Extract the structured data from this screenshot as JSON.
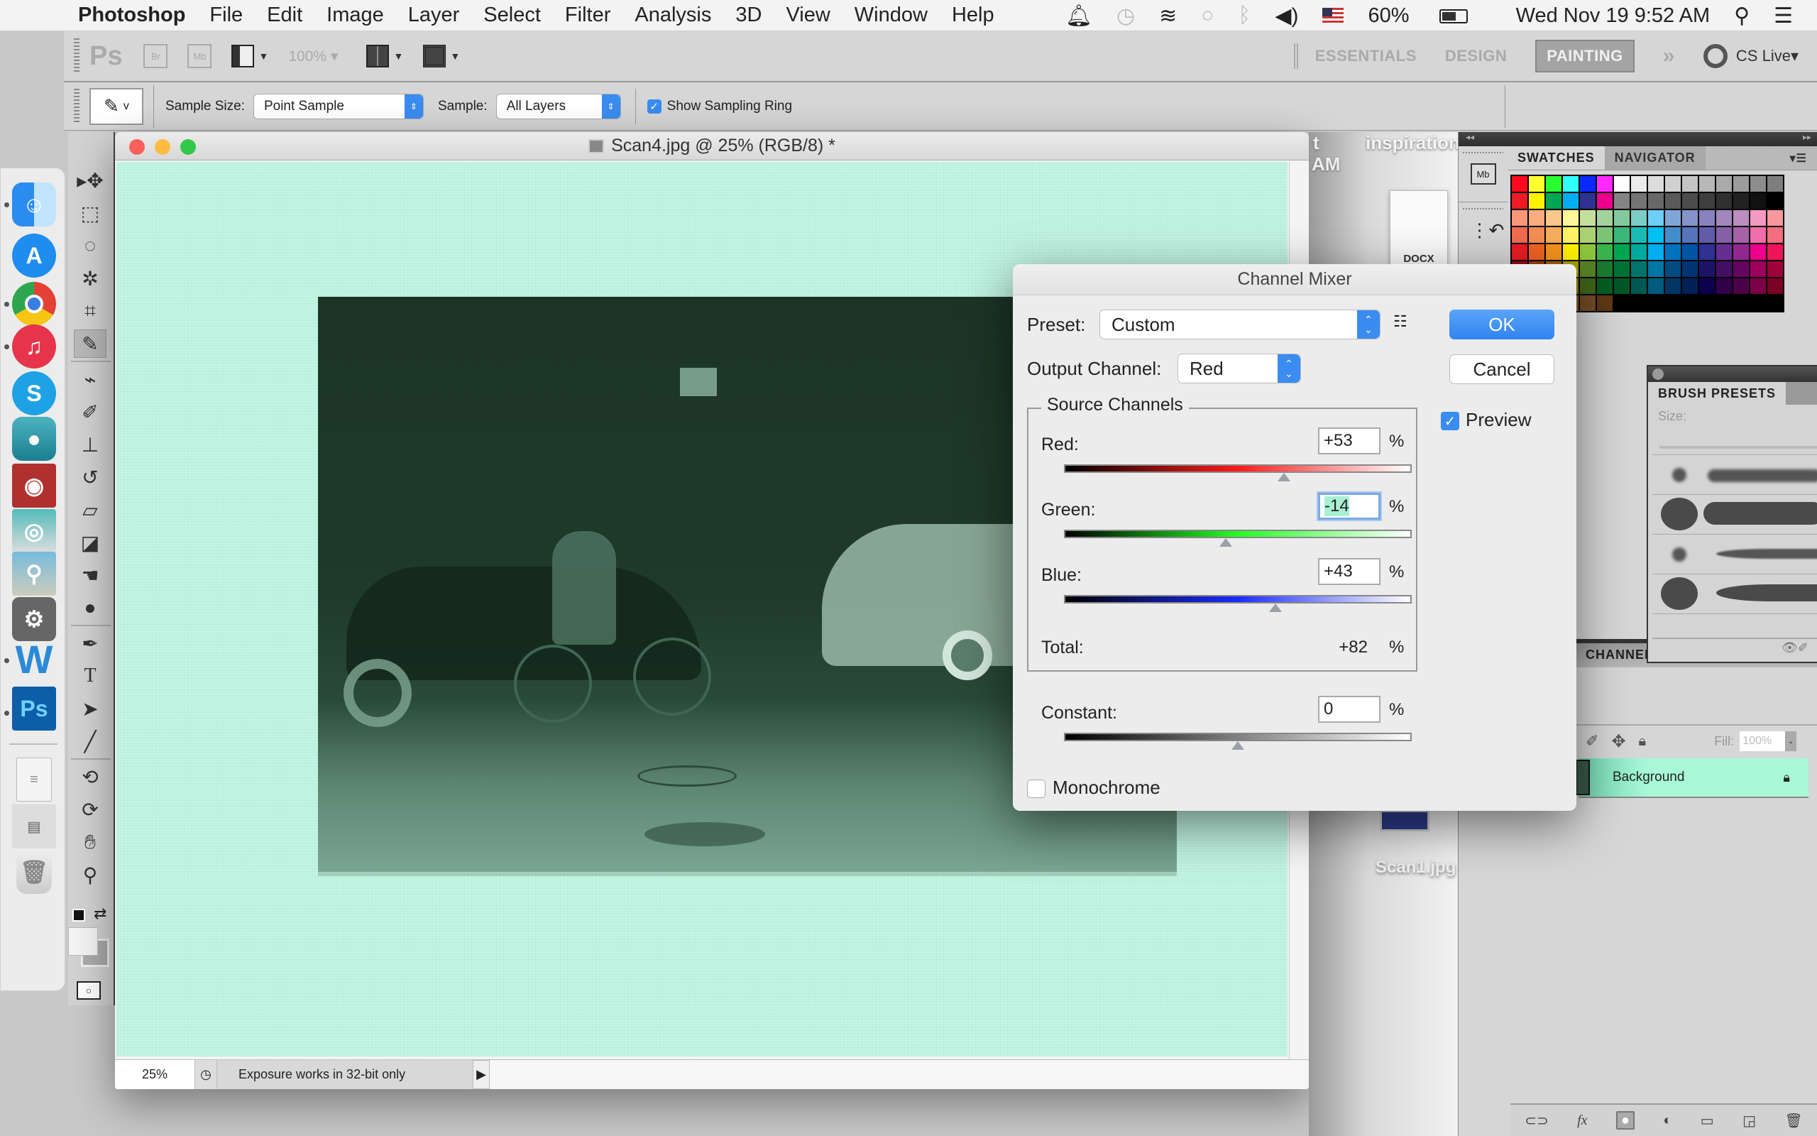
{
  "menubar": {
    "apple": "",
    "app_name": "Photoshop",
    "items": [
      "File",
      "Edit",
      "Image",
      "Layer",
      "Select",
      "Filter",
      "Analysis",
      "3D",
      "View",
      "Window",
      "Help"
    ],
    "status_icons": [
      "notification-bell-icon",
      "time-machine-icon",
      "wifi-icon",
      "messages-icon",
      "bluetooth-icon",
      "volume-icon",
      "input-source-flag-icon"
    ],
    "battery": "60%",
    "datetime": "Wed Nov 19  9:52 AM"
  },
  "appbar": {
    "logo": "Ps",
    "bridge": "Br",
    "mini_bridge": "Mb",
    "zoom_level": "100%",
    "workspaces": [
      "ESSENTIALS",
      "DESIGN",
      "PAINTING"
    ],
    "active_workspace": "PAINTING",
    "more": "»",
    "cs_live": "CS Live"
  },
  "options": {
    "tool_key": "v",
    "sample_size_label": "Sample Size:",
    "sample_size_value": "Point Sample",
    "sample_label": "Sample:",
    "sample_value": "All Layers",
    "show_ring_label": "Show Sampling Ring",
    "show_ring_checked": true
  },
  "dock": {
    "apps": [
      "Finder",
      "App Store",
      "Google Chrome",
      "iTunes",
      "Skype",
      "Silhouette App",
      "Photo Booth",
      "Image Capture",
      "Preview",
      "System Preferences",
      "Microsoft Word",
      "Adobe Photoshop"
    ],
    "docs": [
      "Document stack",
      "Chrome download",
      "Trash"
    ]
  },
  "toolbox": {
    "tools": [
      "move",
      "rectangular-marquee",
      "lasso",
      "quick-selection",
      "crop",
      "eyedropper",
      "spot-healing",
      "brush",
      "clone-stamp",
      "history-brush",
      "eraser",
      "paint-bucket",
      "smudge",
      "dodge",
      "pen",
      "type",
      "path-selection",
      "line",
      "3d-rotate",
      "3d-orbit",
      "hand",
      "zoom"
    ],
    "active_tool": "eyedropper"
  },
  "document": {
    "title": "Scan4.jpg @ 25% (RGB/8) *",
    "zoom": "25%",
    "status": "Exposure works in 32-bit only"
  },
  "desktop": {
    "peek_text_1": "t",
    "peek_text_2": "inspiration",
    "peek_text_3": "AM",
    "docx_label": "DOCX",
    "scan1_label": "Scan1.jpg"
  },
  "swatches_panel": {
    "tabs": [
      "SWATCHES",
      "NAVIGATOR"
    ],
    "active_tab": "SWATCHES",
    "colors": [
      "#ff0a1e",
      "#ffff30",
      "#28ff30",
      "#30ffff",
      "#0a28ff",
      "#ff28ff",
      "#ffffff",
      "#ebebeb",
      "#dcdcdc",
      "#d0d0d0",
      "#c4c4c4",
      "#b8b8b8",
      "#aaaaaa",
      "#9c9c9c",
      "#8c8c8c",
      "#7e7e7e",
      "#ed1c24",
      "#fff200",
      "#00a651",
      "#00aeef",
      "#2e3192",
      "#ec008c",
      "#848484",
      "#747474",
      "#686868",
      "#5a5a5a",
      "#4c4c4c",
      "#3e3e3e",
      "#303030",
      "#222222",
      "#111111",
      "#000000",
      "#f7977a",
      "#f9ad81",
      "#fdc68a",
      "#fff79a",
      "#c4df9b",
      "#a3d39c",
      "#82ca9d",
      "#7bcdc8",
      "#6dcff6",
      "#7ea7d8",
      "#8493ca",
      "#8882be",
      "#a187be",
      "#bc8dbf",
      "#f49ac2",
      "#f6989d",
      "#f26c4f",
      "#f68e56",
      "#fbaf5d",
      "#fff467",
      "#acd372",
      "#7cc576",
      "#3bb878",
      "#1abbb4",
      "#00bff3",
      "#438cca",
      "#5574b9",
      "#605ca8",
      "#855fa8",
      "#a763a8",
      "#f06eaa",
      "#f26d7d",
      "#ed1c24",
      "#f26522",
      "#f7941d",
      "#fff200",
      "#8dc73f",
      "#39b54a",
      "#00a651",
      "#00a99d",
      "#00aeef",
      "#0072bc",
      "#0054a6",
      "#2e3192",
      "#662d91",
      "#92278f",
      "#ec008c",
      "#ed145b",
      "#9e0b0f",
      "#a0410d",
      "#a36209",
      "#aba000",
      "#598527",
      "#1a7b30",
      "#007236",
      "#00746b",
      "#0076a3",
      "#004b80",
      "#003471",
      "#1b1464",
      "#440e62",
      "#630460",
      "#9e005d",
      "#9e0039",
      "#790000",
      "#7b2e00",
      "#7d4900",
      "#827b00",
      "#406618",
      "#005e20",
      "#005826",
      "#005952",
      "#005b7f",
      "#003663",
      "#002157",
      "#0d004c",
      "#32004b",
      "#4b0049",
      "#7b0046",
      "#7a0026",
      "#363636",
      "#c69c6d",
      "#a67c52",
      "#8c6239",
      "#754c24",
      "#603913"
    ]
  },
  "brush_panel": {
    "title": "BRUSH PRESETS",
    "size_label": "Size:"
  },
  "layers_panel": {
    "tab": "CHANNEL",
    "fill_label": "Fill:",
    "fill_value": "100%",
    "layers": [
      {
        "name": "Background",
        "locked": true
      }
    ],
    "footer_icons": [
      "link-layers-icon",
      "fx-icon",
      "layer-mask-icon",
      "adjustment-layer-icon",
      "new-group-icon",
      "new-layer-icon",
      "delete-layer-icon"
    ]
  },
  "dialog": {
    "title": "Channel Mixer",
    "preset_label": "Preset:",
    "preset_value": "Custom",
    "output_label": "Output Channel:",
    "output_value": "Red",
    "ok": "OK",
    "cancel": "Cancel",
    "preview_label": "Preview",
    "preview_checked": true,
    "source_group": "Source Channels",
    "channels": [
      {
        "label": "Red:",
        "value": "+53",
        "percent": 53,
        "from": "#000000",
        "mid": "#ff1a1a",
        "to": "#ffffff"
      },
      {
        "label": "Green:",
        "value": "-14",
        "percent": -14,
        "from": "#000000",
        "mid": "#22ff22",
        "to": "#ffffff"
      },
      {
        "label": "Blue:",
        "value": "+43",
        "percent": 43,
        "from": "#000000",
        "mid": "#1a2bff",
        "to": "#ffffff"
      }
    ],
    "pct": "%",
    "total_label": "Total:",
    "total_value": "+82",
    "constant_label": "Constant:",
    "constant_value": "0",
    "constant_percent": 0,
    "monochrome_label": "Monochrome",
    "monochrome_checked": false
  }
}
